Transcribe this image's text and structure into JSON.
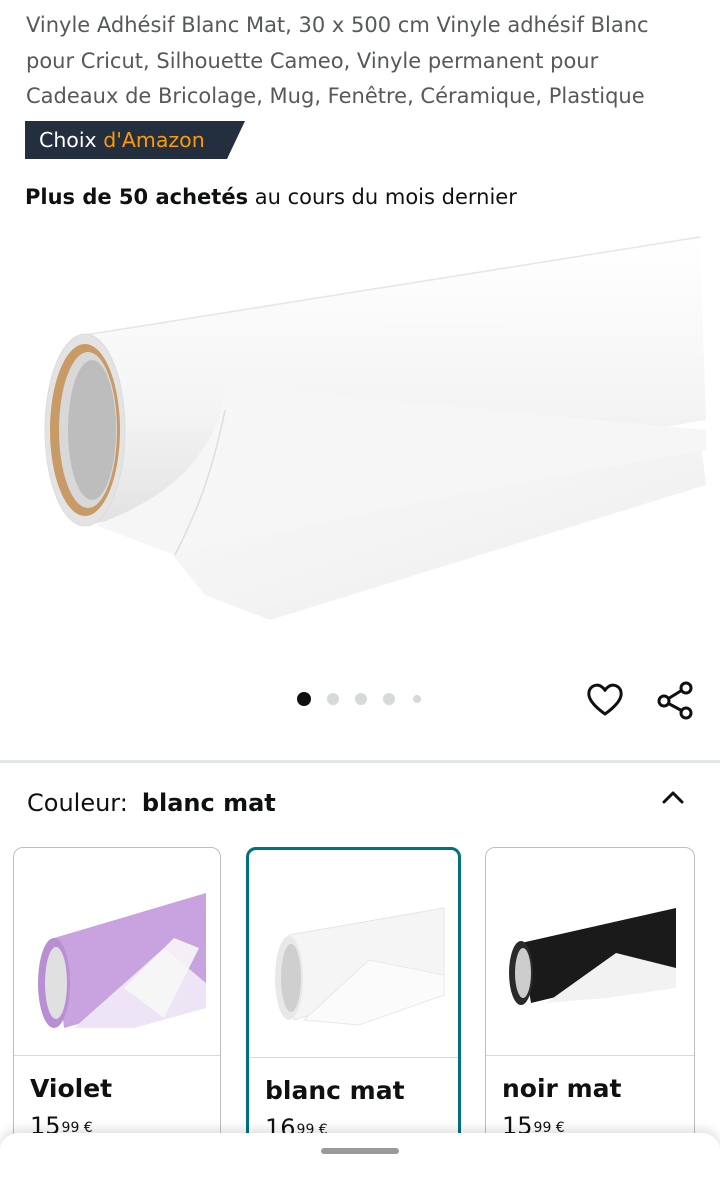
{
  "product": {
    "title_lines": [
      "Vinyle Adhésif Blanc Mat, 30 x 500 cm Vinyle adhésif Blanc",
      "pour Cricut, Silhouette Cameo, Vinyle permanent pour",
      "Cadeaux de Bricolage, Mug, Fenêtre, Céramique, Plastique"
    ],
    "badge": {
      "part1": "Choix",
      "part2": "d'Amazon"
    },
    "bought": {
      "bold": "Plus de 50 achetés",
      "rest": " au cours du mois dernier"
    },
    "main_image_icon": "white-vinyl-roll-image",
    "carousel": {
      "total": 5,
      "active_index": 1
    }
  },
  "actions": {
    "favorite_icon": "heart-icon",
    "share_icon": "share-icon"
  },
  "color_selector": {
    "label": "Couleur:",
    "selected": "blanc mat",
    "collapse_icon": "chevron-up-icon",
    "options": [
      {
        "name": "Violet",
        "price_main": "15",
        "price_sup": "99 €",
        "swatch": "#c9a3e0",
        "selected": false
      },
      {
        "name": "blanc mat",
        "price_main": "16",
        "price_sup": "99 €",
        "swatch": "#ffffff",
        "selected": true
      },
      {
        "name": "noir mat",
        "price_main": "15",
        "price_sup": "99 €",
        "swatch": "#1a1a1a",
        "selected": false
      }
    ]
  },
  "colors": {
    "badge_bg": "#232f3e",
    "badge_accent": "#ff9900",
    "selected_border": "#007185"
  }
}
